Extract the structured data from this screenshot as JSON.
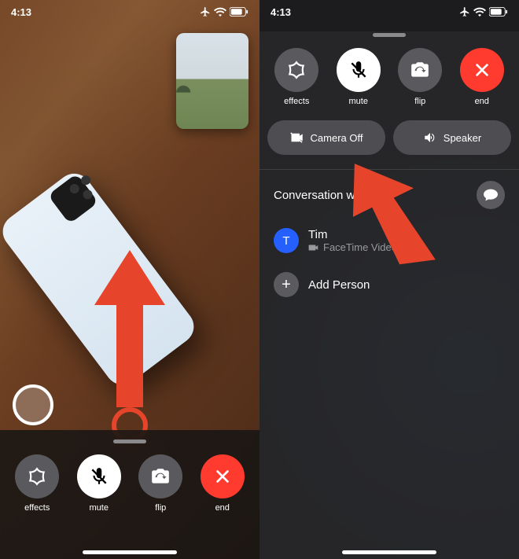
{
  "status": {
    "time": "4:13"
  },
  "controls": {
    "effects": "effects",
    "mute": "mute",
    "flip": "flip",
    "end": "end"
  },
  "pills": {
    "camera_off": "Camera Off",
    "speaker": "Speaker"
  },
  "conversation": {
    "header": "Conversation wit",
    "person": {
      "initial": "T",
      "name": "Tim",
      "sub": "FaceTime Video"
    },
    "add": "Add Person"
  }
}
